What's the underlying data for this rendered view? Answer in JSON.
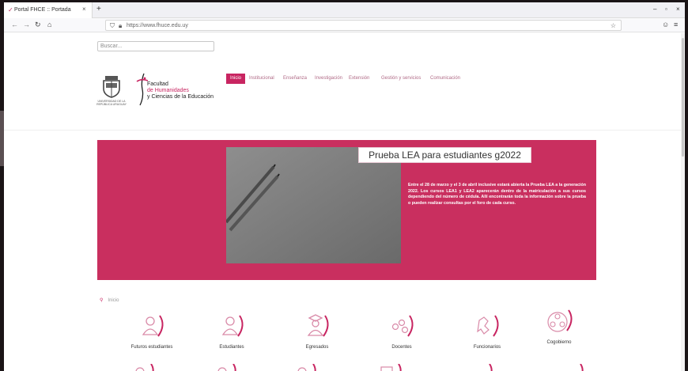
{
  "browser": {
    "tab_title": "Portal FHCE :: Portada",
    "tab_close": "×",
    "new_tab": "+",
    "url": "https://www.fhuce.edu.uy",
    "window_controls": [
      "–",
      "▫",
      "×"
    ]
  },
  "page": {
    "search_placeholder": "Buscar...",
    "logo_university_text": "UNIVERSIDAD DE LA REPÚBLICA URUGUAY",
    "faculty_name_line1": "Facultad",
    "faculty_name_line2": "de Humanidades",
    "faculty_name_line3": "y Ciencias de la Educación",
    "menu": [
      {
        "label": "Inicio",
        "active": true
      },
      {
        "label": "Institucional"
      },
      {
        "label": "Enseñanza"
      },
      {
        "label": "Investigación"
      },
      {
        "label": "Extensión"
      },
      {
        "label": "Gestión y servicios"
      },
      {
        "label": "Comunicación"
      }
    ],
    "banner": {
      "title": "Prueba LEA para estudiantes g2022",
      "body": "Entre el 28 de marzo y el 3 de abril inclusive estará abierta la Prueba LEA a la generación 2022. Los cursos LEA1 y LEA2 aparecerán dentro de la matriculación a sus cursos dependiendo del número de cédula. Allí encontrarán toda la información sobre la prueba o pueden realizar consultas por el foro de cada curso.",
      "background_color": "#c92f5f"
    },
    "breadcrumb": "Inicio",
    "categories": [
      {
        "label": "Futuros estudiantes",
        "icon": "future-students-icon"
      },
      {
        "label": "Estudiantes",
        "icon": "students-icon"
      },
      {
        "label": "Egresados",
        "icon": "graduates-icon"
      },
      {
        "label": "Docentes",
        "icon": "teachers-icon"
      },
      {
        "label": "Funcionarios",
        "icon": "staff-icon"
      },
      {
        "label": "Cogobierno",
        "icon": "cogovernment-icon"
      }
    ]
  },
  "colors": {
    "accent": "#c82561",
    "menu_text": "#b06a86"
  }
}
